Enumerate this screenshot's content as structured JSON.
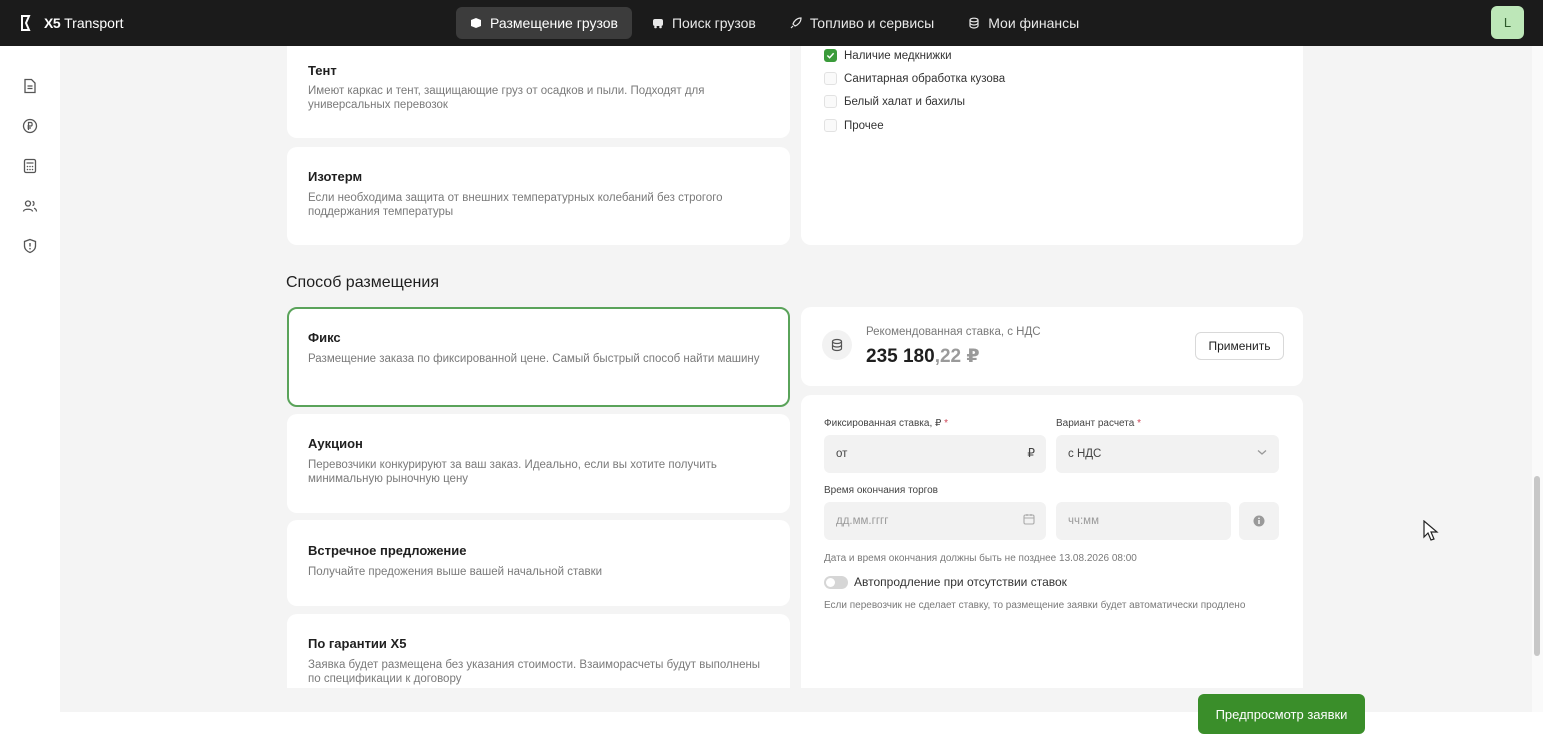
{
  "header": {
    "logo_mark": "X5",
    "logo_text": "Transport",
    "nav": [
      {
        "label": "Размещение грузов",
        "icon": "box-icon",
        "active": true
      },
      {
        "label": "Поиск грузов",
        "icon": "truck-icon",
        "active": false
      },
      {
        "label": "Топливо и сервисы",
        "icon": "rocket-icon",
        "active": false
      },
      {
        "label": "Мои финансы",
        "icon": "coins-icon",
        "active": false
      }
    ],
    "avatar_initial": "L"
  },
  "sidebar": {
    "icons": [
      "document-icon",
      "ruble-icon",
      "calculator-icon",
      "users-icon",
      "shield-icon"
    ],
    "expand_icon": "chevron-right-icon"
  },
  "body_types": [
    {
      "title": "Тент",
      "desc": "Имеют каркас и тент, защищающие груз от осадков и пыли. Подходят для универсальных перевозок"
    },
    {
      "title": "Изотерм",
      "desc": "Если необходима защита от внешних температурных колебаний без строгого поддержания температуры"
    }
  ],
  "requirements": [
    {
      "label": "Наличие медкнижки",
      "checked": true
    },
    {
      "label": "Санитарная обработка кузова",
      "checked": false
    },
    {
      "label": "Белый халат и бахилы",
      "checked": false
    },
    {
      "label": "Прочее",
      "checked": false
    }
  ],
  "placement": {
    "section_title": "Способ размещения",
    "options": [
      {
        "title": "Фикс",
        "desc": "Размещение заказа по фиксированной цене. Самый быстрый способ найти машину",
        "selected": true
      },
      {
        "title": "Аукцион",
        "desc": "Перевозчики конкурируют за ваш заказ. Идеально, если вы хотите получить минимальную рыночную цену",
        "selected": false
      },
      {
        "title": "Встречное предложение",
        "desc": "Получайте предожения выше вашей начальной ставки",
        "selected": false
      },
      {
        "title": "По гарантии X5",
        "desc": "Заявка будет размещена без указания стоимости. Взаиморасчеты будут выполнены по спецификации к договору",
        "selected": false
      }
    ]
  },
  "rate": {
    "label": "Рекомендованная ставка, с НДС",
    "value_int": "235 180",
    "value_frac": ",22 ₽",
    "apply_label": "Применить",
    "icon": "coins-icon"
  },
  "form": {
    "fixed_rate_label": "Фиксированная ставка, ₽",
    "fixed_rate_placeholder": "от",
    "currency": "₽",
    "calc_label": "Вариант расчета",
    "calc_value": "с НДС",
    "end_time_label": "Время окончания торгов",
    "date_placeholder": "дд.мм.гггг",
    "time_placeholder": "чч:мм",
    "required_mark": "*",
    "date_hint": "Дата и время окончания должны быть не позднее 13.08.2026 08:00",
    "auto_extend_label": "Автопродление при отсутствии ставок",
    "auto_extend_on": false,
    "auto_extend_hint": "Если перевозчик не сделает ставку, то размещение заявки будет автоматически продлено"
  },
  "footer": {
    "preview_label": "Предпросмотр заявки"
  },
  "colors": {
    "accent": "#3a8e2a",
    "selected_border": "#5aa35a",
    "topbar": "#1b1b1b",
    "avatar_bg": "#bde7b8"
  }
}
